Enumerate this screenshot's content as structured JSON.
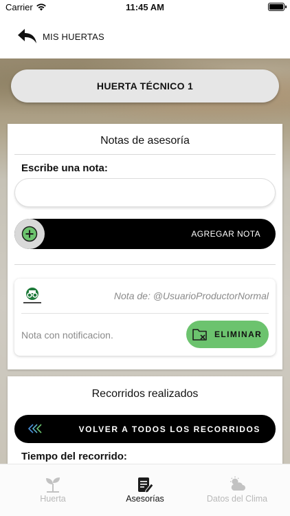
{
  "status_bar": {
    "carrier": "Carrier",
    "time": "11:45 AM"
  },
  "header": {
    "title": "MIS HUERTAS"
  },
  "garden": {
    "name": "HUERTA TÉCNICO 1"
  },
  "notes_section": {
    "title": "Notas de asesoría",
    "input_label": "Escribe una nota:",
    "input_value": "",
    "add_button_label": "AGREGAR NOTA",
    "notes": [
      {
        "author": "Nota de: @UsuarioProductorNormal",
        "text": "Nota con notificacion.",
        "delete_label": "ELIMINAR"
      }
    ]
  },
  "routes_section": {
    "title": "Recorridos realizados",
    "back_button_label": "VOLVER A TODOS LOS RECORRIDOS",
    "time_label": "Tiempo del recorrido:"
  },
  "tab_bar": {
    "tabs": [
      {
        "label": "Huerta",
        "icon": "sprout-icon",
        "active": false
      },
      {
        "label": "Asesorías",
        "icon": "notes-edit-icon",
        "active": true
      },
      {
        "label": "Datos del Clima",
        "icon": "weather-icon",
        "active": false
      }
    ]
  },
  "colors": {
    "accent_green": "#6cc36e",
    "button_dark": "#000000",
    "inactive_tab": "#b8b8b8"
  }
}
